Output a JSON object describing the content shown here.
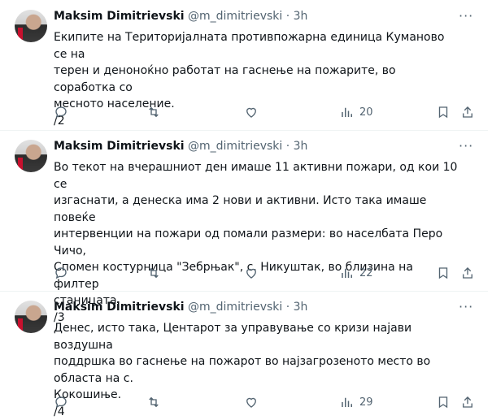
{
  "tweets": [
    {
      "name": "Maksim Dimitrievski",
      "handle": "@m_dimitrievski",
      "time": "3h",
      "text": "Екипите на Територијалната противпожарна единица Куманово се на\nтерен и денонoќно работат на гаснење на пожарите, во соработка со\nмесното население.\n/2",
      "views": "20"
    },
    {
      "name": "Maksim Dimitrievski",
      "handle": "@m_dimitrievski",
      "time": "3h",
      "text": "Во текот на вчерашниот ден имаше 11 активни пожари, од кои 10 се\nизгаснати, а денеска има 2 нови и активни. Исто така имаше повеќе\nинтервенции на пожари од помали размери: во населбата Перо Чичо,\nСпомен костурница \"Зебрњак\", с. Никуштак, во близина на филтер\nстаницата.\n/3",
      "views": "22"
    },
    {
      "name": "Maksim Dimitrievski",
      "handle": "@m_dimitrievski",
      "time": "3h",
      "text": "Денес, исто така, Центарот за управување со кризи најави воздушна\nподдршка во гаснење на пожарот во најзагрозеното место во областа на с.\nКокошиње.\n/4",
      "views": "29"
    }
  ],
  "icons": {
    "more": "more-icon",
    "reply": "reply-icon",
    "retweet": "retweet-icon",
    "like": "like-icon",
    "views": "views-icon",
    "bookmark": "bookmark-icon",
    "share": "share-icon"
  },
  "colors": {
    "text": "#0f1419",
    "muted": "#536471",
    "border": "#eff3f4"
  }
}
